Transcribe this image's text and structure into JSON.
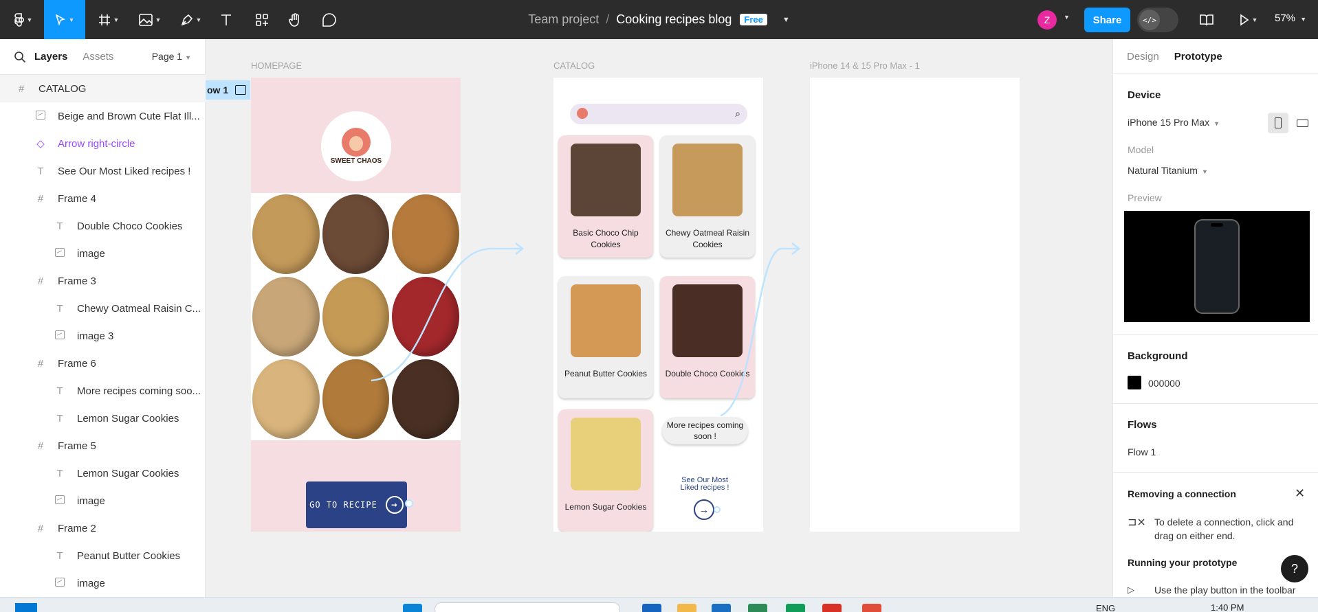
{
  "toolbar": {
    "team": "Team project",
    "separator": "/",
    "file_name": "Cooking recipes blog",
    "plan_badge": "Free",
    "avatar_initial": "Z",
    "share_label": "Share",
    "dev_mode_glyph": "</>",
    "zoom": "57%",
    "tools": [
      "figma-menu-icon",
      "move-tool-icon",
      "frame-tool-icon",
      "image-tool-icon",
      "pen-tool-icon",
      "text-tool-icon",
      "components-icon",
      "hand-tool-icon",
      "comment-tool-icon"
    ]
  },
  "left_panel": {
    "tabs": {
      "layers": "Layers",
      "assets": "Assets"
    },
    "page": "Page 1",
    "layers": [
      {
        "label": "CATALOG",
        "icon": "frame",
        "indent": 0
      },
      {
        "label": "Beige and Brown Cute Flat Ill...",
        "icon": "image",
        "indent": 1
      },
      {
        "label": "Arrow right-circle",
        "icon": "component",
        "indent": 1
      },
      {
        "label": "See Our Most Liked recipes !",
        "icon": "text",
        "indent": 1
      },
      {
        "label": "Frame 4",
        "icon": "frame",
        "indent": 1
      },
      {
        "label": "Double Choco Cookies",
        "icon": "text",
        "indent": 2
      },
      {
        "label": "image",
        "icon": "image",
        "indent": 2
      },
      {
        "label": "Frame 3",
        "icon": "frame",
        "indent": 1
      },
      {
        "label": "Chewy Oatmeal Raisin C...",
        "icon": "text",
        "indent": 2
      },
      {
        "label": "image 3",
        "icon": "image",
        "indent": 2
      },
      {
        "label": "Frame 6",
        "icon": "frame",
        "indent": 1
      },
      {
        "label": "More recipes coming soo...",
        "icon": "text",
        "indent": 2
      },
      {
        "label": "Lemon Sugar Cookies",
        "icon": "text",
        "indent": 2
      },
      {
        "label": "Frame 5",
        "icon": "frame",
        "indent": 1
      },
      {
        "label": "Lemon Sugar Cookies",
        "icon": "text",
        "indent": 2
      },
      {
        "label": "image",
        "icon": "image",
        "indent": 2
      },
      {
        "label": "Frame 2",
        "icon": "frame",
        "indent": 1
      },
      {
        "label": "Peanut Butter Cookies",
        "icon": "text",
        "indent": 2
      },
      {
        "label": "image",
        "icon": "image",
        "indent": 2
      }
    ]
  },
  "canvas": {
    "frames": {
      "homepage": "HOMEPAGE",
      "catalog": "CATALOG",
      "iphone": "iPhone 14 & 15 Pro Max - 1"
    },
    "flow_tag": "ow 1",
    "homepage": {
      "logo_text": "SWEET CHAOS",
      "go_button": "GO TO RECIPE",
      "cookie_colors": [
        "#c49a5a",
        "#6b4a36",
        "#b57a3c",
        "#c8a678",
        "#c59a55",
        "#a3282c",
        "#d9b47c",
        "#b07a3a",
        "#4a3024"
      ]
    },
    "catalog": {
      "cards": [
        {
          "label": "Basic Choco Chip Cookies",
          "style": "pink",
          "image_color": "#5c4536"
        },
        {
          "label": "Chewy Oatmeal Raisin Cookies",
          "style": "grey",
          "image_color": "#c69a5b"
        },
        {
          "label": "Peanut Butter Cookies",
          "style": "grey",
          "image_color": "#d49a55"
        },
        {
          "label": "Double Choco Cookies",
          "style": "pink",
          "image_color": "#4a2e25"
        },
        {
          "label": "Lemon Sugar Cookies",
          "style": "pink",
          "image_color": "#e8d07a"
        }
      ],
      "soon_text": "More recipes coming soon !",
      "liked_text": "See Our Most Liked recipes !"
    }
  },
  "right_panel": {
    "tabs": {
      "design": "Design",
      "prototype": "Prototype"
    },
    "device_heading": "Device",
    "device_value": "iPhone 15 Pro Max",
    "model_label": "Model",
    "model_value": "Natural Titanium",
    "preview_label": "Preview",
    "background_heading": "Background",
    "background_value": "000000",
    "flows_heading": "Flows",
    "flow_name": "Flow 1",
    "info_title": "Removing a connection",
    "info_text": "To delete a connection, click and drag on either end.",
    "running_title": "Running your prototype",
    "running_text": "Use the play button in the toolbar",
    "help": "?"
  },
  "taskbar": {
    "language": "ENG",
    "time": "1:40 PM",
    "app_colors": [
      "#0a84d6",
      "#1565c0",
      "#f2b94a",
      "#1a6fc4",
      "#2e8b57",
      "#0f9d58",
      "#d93025",
      "#e04e39"
    ]
  }
}
